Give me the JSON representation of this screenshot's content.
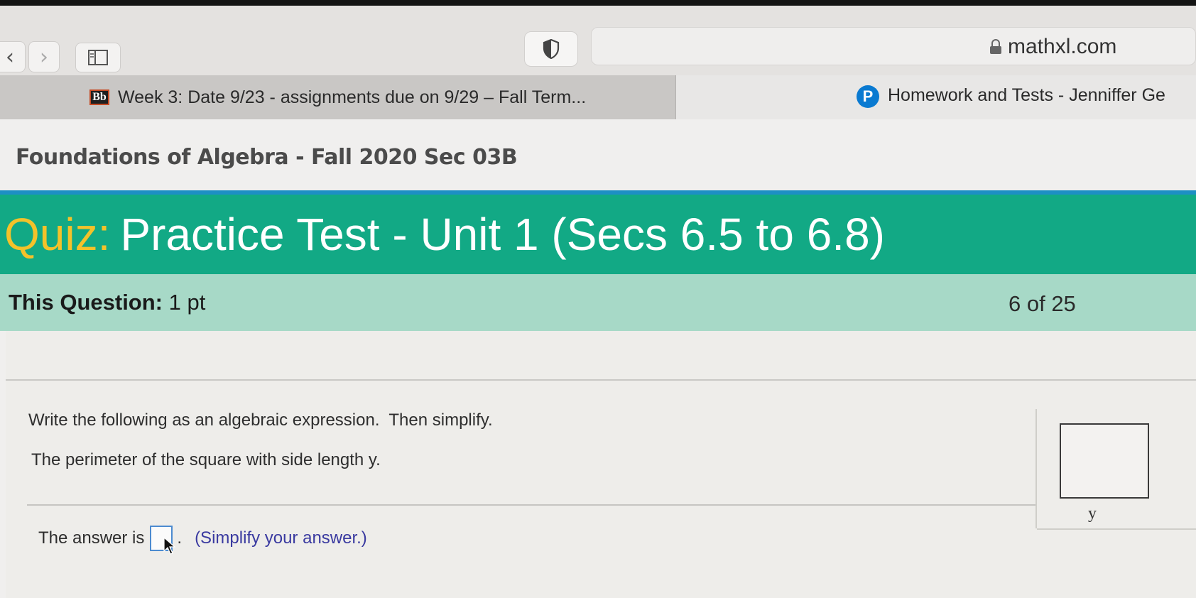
{
  "browser": {
    "url": "mathxl.com"
  },
  "tabs": [
    {
      "label": "Week 3: Date 9/23 - assignments due on 9/29 – Fall Term...",
      "icon": "Bb"
    },
    {
      "label": "Homework and Tests - Jenniffer Ge",
      "icon": "P"
    }
  ],
  "page": {
    "course_title": "Foundations of Algebra - Fall 2020 Sec 03B",
    "quiz_label": "Quiz:",
    "quiz_title": "Practice Test - Unit 1 (Secs 6.5 to 6.8)",
    "question_label": "This Question:",
    "question_points": "1 pt",
    "progress": "6 of 25"
  },
  "question": {
    "instruction": "Write the following as an algebraic expression.  Then simplify.",
    "problem": "The perimeter of the square with side length y.",
    "figure_label": "y",
    "answer_prefix": "The answer is",
    "answer_value": "",
    "answer_hint": "(Simplify your answer.)"
  },
  "colors": {
    "quiz_banner": "#12a985",
    "quiz_label": "#f4c22a",
    "question_bar": "#a7d9c7",
    "accent": "#1d8fc4"
  }
}
